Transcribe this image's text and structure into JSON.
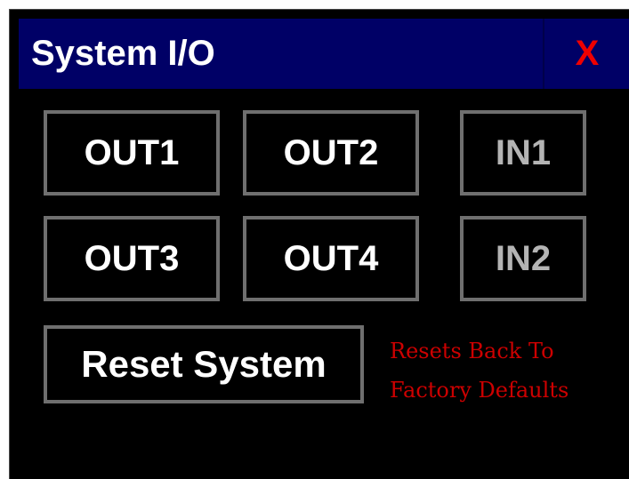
{
  "window": {
    "title": "System I/O",
    "close_label": "X"
  },
  "outputs": [
    {
      "label": "OUT1"
    },
    {
      "label": "OUT2"
    },
    {
      "label": "OUT3"
    },
    {
      "label": "OUT4"
    }
  ],
  "inputs": [
    {
      "label": "IN1"
    },
    {
      "label": "IN2"
    }
  ],
  "reset": {
    "button_label": "Reset System",
    "note_line1": "Resets Back To",
    "note_line2": "Factory Defaults"
  },
  "colors": {
    "titlebar": "#000066",
    "close": "#ee0000",
    "note": "#cc0000",
    "button_border": "#6f6f6f",
    "input_text": "#b4b4b4"
  }
}
